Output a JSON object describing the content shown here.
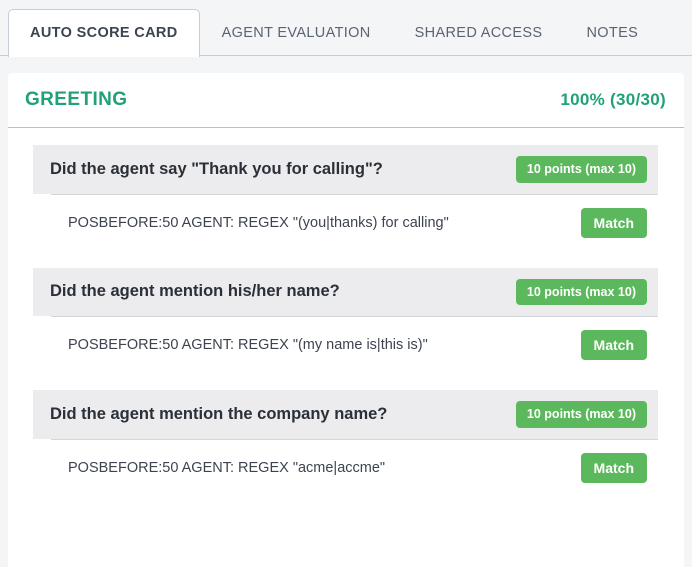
{
  "tabs": [
    {
      "label": "AUTO SCORE CARD",
      "active": true
    },
    {
      "label": "AGENT EVALUATION",
      "active": false
    },
    {
      "label": "SHARED ACCESS",
      "active": false
    },
    {
      "label": "NOTES",
      "active": false
    }
  ],
  "section": {
    "title": "GREETING",
    "score": "100%  (30/30)"
  },
  "colors": {
    "accent_teal": "#21a179",
    "badge_green": "#5cb85c",
    "page_background": "#f4f5f7",
    "question_header_background": "#ececee"
  },
  "questions": [
    {
      "text": "Did the agent say \"Thank you for calling\"?",
      "points_badge": "10 points (max 10)",
      "criteria": [
        {
          "rule": "POSBEFORE:50 AGENT: REGEX \"(you|thanks) for calling\"",
          "status": "Match"
        }
      ]
    },
    {
      "text": "Did the agent mention his/her name?",
      "points_badge": "10 points (max 10)",
      "criteria": [
        {
          "rule": "POSBEFORE:50 AGENT: REGEX \"(my name is|this is)\"",
          "status": "Match"
        }
      ]
    },
    {
      "text": "Did the agent mention the company name?",
      "points_badge": "10 points (max 10)",
      "criteria": [
        {
          "rule": "POSBEFORE:50 AGENT: REGEX \"acme|accme\"",
          "status": "Match"
        }
      ]
    }
  ]
}
